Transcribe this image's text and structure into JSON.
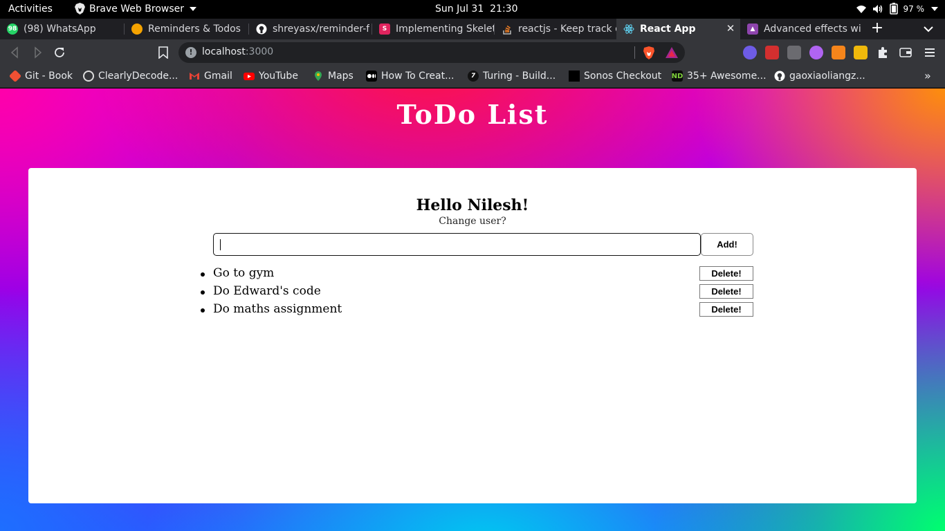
{
  "system_bar": {
    "activities": "Activities",
    "app_name": "Brave Web Browser",
    "clock": "Sun Jul 31  21:30",
    "battery": "97 %"
  },
  "tabs": [
    {
      "title": "(98) WhatsApp",
      "icon": "whatsapp-icon",
      "color": "#25d366",
      "badge": "98"
    },
    {
      "title": "Reminders & Todos",
      "icon": "reminders-icon",
      "color": "#f5a300"
    },
    {
      "title": "shreyasx/reminder-f",
      "icon": "github-icon",
      "color": "#ffffff"
    },
    {
      "title": "Implementing Skelet",
      "icon": "s-logo-icon",
      "color": "#e0245e"
    },
    {
      "title": "reactjs - Keep track o",
      "icon": "stackoverflow-icon",
      "color": "#f48024"
    },
    {
      "title": "React App",
      "icon": "react-icon",
      "color": "#61dafb",
      "active": true
    },
    {
      "title": "Advanced effects wi",
      "icon": "advanced-effects-icon",
      "color": "#8e44ad"
    }
  ],
  "toolbar": {
    "url_host": "localhost",
    "url_port": ":3000"
  },
  "bookmarks": [
    {
      "label": "Git - Book",
      "icon": "git-icon",
      "color": "#f05033"
    },
    {
      "label": "ClearlyDecode...",
      "icon": "clearlydecoded-icon",
      "color": "#dddddd"
    },
    {
      "label": "Gmail",
      "icon": "gmail-icon",
      "color": "#ea4335"
    },
    {
      "label": "YouTube",
      "icon": "youtube-icon",
      "color": "#ff0000"
    },
    {
      "label": "Maps",
      "icon": "maps-icon",
      "color": "#34a853"
    },
    {
      "label": "How To Creat...",
      "icon": "medium-icon",
      "color": "#000000"
    },
    {
      "label": "Turing - Build...",
      "icon": "turing-icon",
      "color": "#111111"
    },
    {
      "label": "Sonos Checkout",
      "icon": "sonos-icon",
      "color": "#000000"
    },
    {
      "label": "35+ Awesome...",
      "icon": "nd-icon",
      "color": "#0a0a0a"
    },
    {
      "label": "gaoxiaoliangz...",
      "icon": "github-icon",
      "color": "#ffffff"
    }
  ],
  "app": {
    "title": "ToDo List",
    "greeting": "Hello Nilesh!",
    "change_user": "Change user?",
    "input_value": "",
    "add_label": "Add!",
    "todos": [
      {
        "text": "Go to gym",
        "delete_label": "Delete!"
      },
      {
        "text": "Do Edward's code",
        "delete_label": "Delete!"
      },
      {
        "text": "Do maths assignment",
        "delete_label": "Delete!"
      }
    ]
  }
}
